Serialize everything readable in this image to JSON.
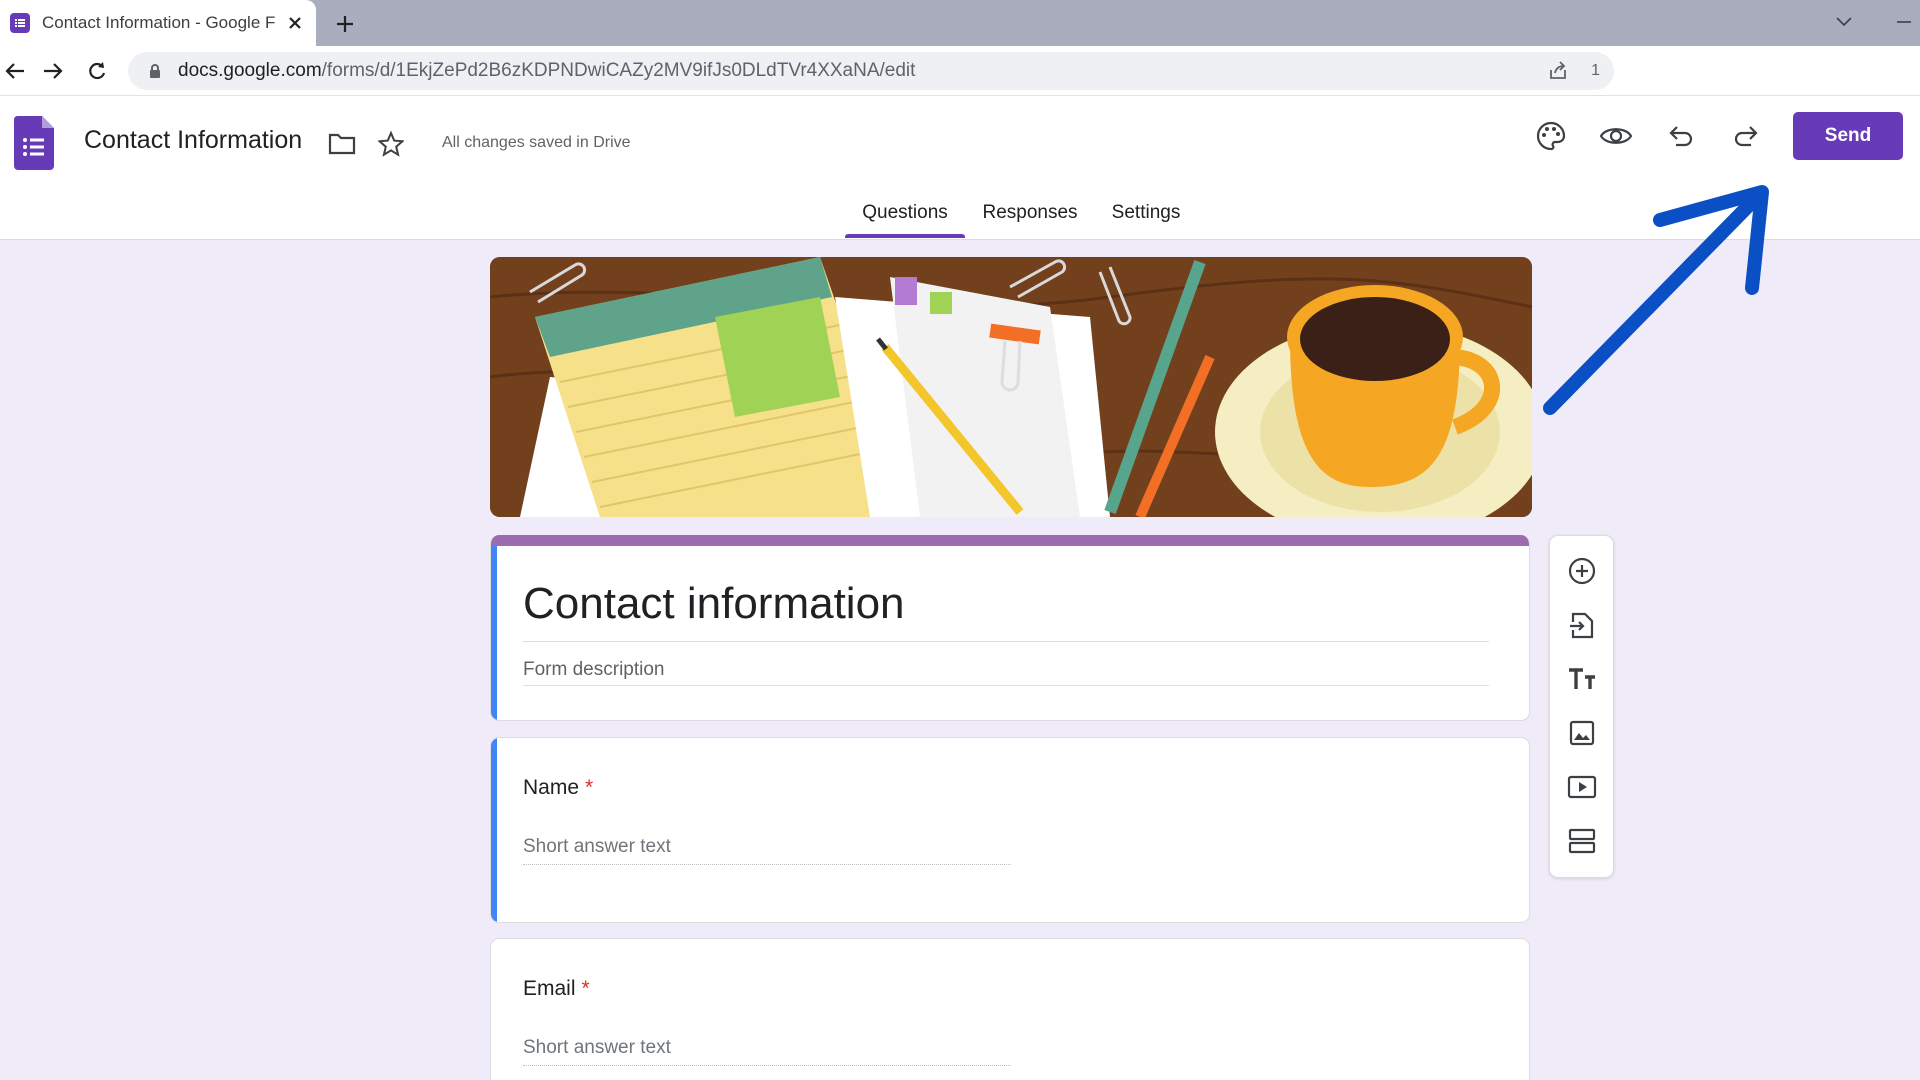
{
  "browser": {
    "tab_title": "Contact Information - Google Forms",
    "url_host": "docs.google.com",
    "url_path": "/forms/d/1EkjZePd2B6zKDPNDwiCAZy2MV9ifJs0DLdTVr4XXaNA/edit",
    "omnibox_extra": "1"
  },
  "header": {
    "doc_title": "Contact Information",
    "saved_status": "All changes saved in Drive",
    "send_label": "Send"
  },
  "tabs": [
    {
      "label": "Questions",
      "active": true
    },
    {
      "label": "Responses",
      "active": false
    },
    {
      "label": "Settings",
      "active": false
    }
  ],
  "form": {
    "title": "Contact information",
    "description_placeholder": "Form description",
    "questions": [
      {
        "label": "Name",
        "required_mark": "*",
        "answer_placeholder": "Short answer text"
      },
      {
        "label": "Email",
        "required_mark": "*",
        "answer_placeholder": "Short answer text"
      }
    ]
  },
  "side_toolbar": [
    {
      "icon": "add-circle-icon"
    },
    {
      "icon": "import-questions-icon"
    },
    {
      "icon": "title-text-icon"
    },
    {
      "icon": "image-icon"
    },
    {
      "icon": "video-icon"
    },
    {
      "icon": "section-icon"
    }
  ],
  "colors": {
    "accent": "#673ab7",
    "page_background": "#f0ebf8",
    "card_left_accent": "#4285f4",
    "title_card_top": "#9c6bb0",
    "annotation_arrow": "#0a4fc4"
  }
}
